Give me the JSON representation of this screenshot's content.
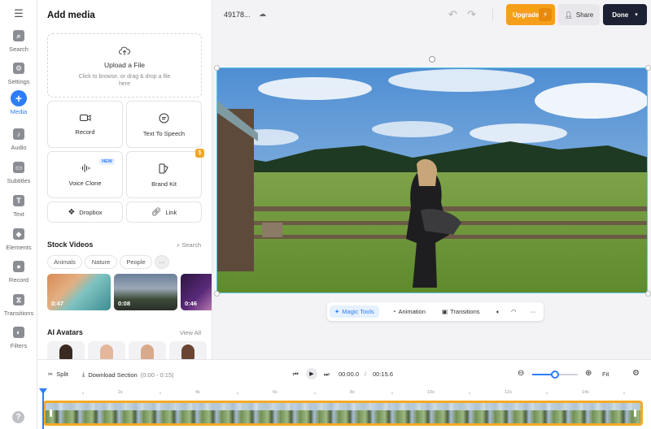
{
  "rail": {
    "items": [
      {
        "label": "Search",
        "glyph": "⌕"
      },
      {
        "label": "Settings",
        "glyph": "⚙"
      },
      {
        "label": "Media",
        "glyph": "+"
      },
      {
        "label": "Audio",
        "glyph": "♪"
      },
      {
        "label": "Subtitles",
        "glyph": "▭"
      },
      {
        "label": "Text",
        "glyph": "T"
      },
      {
        "label": "Elements",
        "glyph": "◆"
      },
      {
        "label": "Record",
        "glyph": "●"
      },
      {
        "label": "Transitions",
        "glyph": "⧖"
      },
      {
        "label": "Filters",
        "glyph": "◐"
      }
    ],
    "help": "?"
  },
  "panel": {
    "title": "Add media",
    "upload": {
      "title": "Upload a File",
      "hint": "Click to browse, or drag & drop a file here"
    },
    "cards": {
      "record": "Record",
      "tts": "Text To Speech",
      "voice_clone": "Voice Clone",
      "voice_badge": "NEW",
      "brand_kit": "Brand Kit",
      "brand_badge": "$",
      "dropbox": "Dropbox",
      "link": "Link"
    },
    "stock": {
      "title": "Stock Videos",
      "search": "Search",
      "chips": [
        "Animals",
        "Nature",
        "People"
      ],
      "more": "···",
      "thumbs": [
        "0:47",
        "0:08",
        "0:46"
      ]
    },
    "avatars": {
      "title": "AI Avatars",
      "view_all": "View All"
    }
  },
  "topbar": {
    "project": "49178...",
    "upgrade": "Upgrade",
    "share": "Share",
    "done": "Done"
  },
  "video_toolbar": {
    "magic": "Magic Tools",
    "animation": "Animation",
    "transitions": "Transitions",
    "more": "···"
  },
  "timeline": {
    "split": "Split",
    "download": "Download Section",
    "download_range": "(0:00 - 0:15)",
    "current": "00:00.0",
    "sep": "/",
    "total": "00:15.6",
    "fit": "Fit",
    "zoom_level": 0.5,
    "ticks": [
      "2s",
      "4s",
      "6s",
      "8s",
      "10s",
      "12s",
      "14s"
    ]
  },
  "colors": {
    "accent": "#2f7df6",
    "upgrade": "#f59f1b",
    "done": "#1c2233",
    "track_border": "#f6a926"
  }
}
